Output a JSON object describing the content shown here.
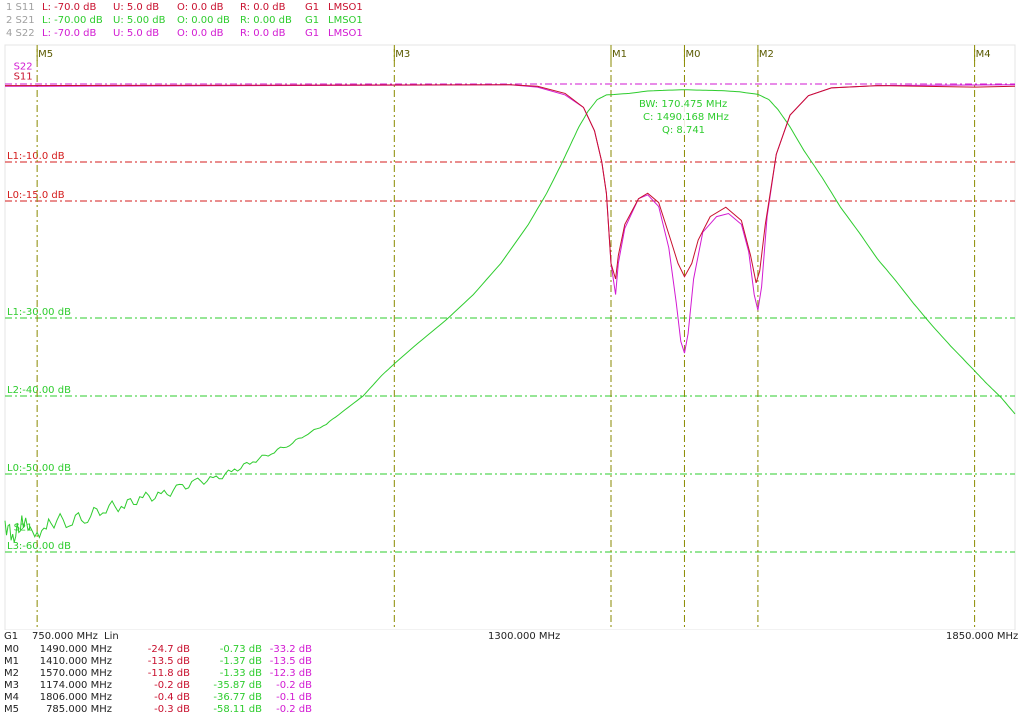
{
  "traces": [
    {
      "name": "1 S11",
      "L": "L: -70.0 dB",
      "U": "U: 5.0 dB",
      "O": "O: 0.0 dB",
      "R": "R: 0.0 dB",
      "group": "G1",
      "lms": "LMSO1",
      "color": "#c8102e",
      "namecolor": "#a0a0a0"
    },
    {
      "name": "2 S21",
      "L": "L: -70.00 dB",
      "U": "U: 5.00 dB",
      "O": "O: 0.00 dB",
      "R": "R: 0.00 dB",
      "group": "G1",
      "lms": "LMSO1",
      "color": "#2ecc2e",
      "namecolor": "#a0a0a0"
    },
    {
      "name": "4 S22",
      "L": "L: -70.0 dB",
      "U": "U: 5.0 dB",
      "O": "O: 0.0 dB",
      "R": "R: 0.0 dB",
      "group": "G1",
      "lms": "LMSO1",
      "color": "#d21ad2",
      "namecolor": "#a0a0a0"
    }
  ],
  "chart_data": {
    "type": "line",
    "x_unit": "MHz",
    "xlim": [
      750,
      1850
    ],
    "ylim": [
      -70,
      5
    ],
    "x_axis": {
      "group": "G1",
      "start": "750.000 MHz",
      "scale": "Lin",
      "center": "1300.000 MHz",
      "stop": "1850.000 MHz"
    },
    "limit_lines": [
      {
        "label": "L1:-10.0 dB",
        "value": -10,
        "color": "#d41c1c"
      },
      {
        "label": "L0:-15.0 dB",
        "value": -15,
        "color": "#d41c1c"
      },
      {
        "label": "L1:-30.00 dB",
        "value": -30,
        "color": "#2ecc2e"
      },
      {
        "label": "L2:-40.00 dB",
        "value": -40,
        "color": "#2ecc2e"
      },
      {
        "label": "L0:-50.00 dB",
        "value": -50,
        "color": "#2ecc2e"
      },
      {
        "label": "L3:-60.00 dB",
        "value": -60,
        "color": "#2ecc2e"
      }
    ],
    "markers": [
      {
        "name": "M5",
        "x": 785
      },
      {
        "name": "M3",
        "x": 1174
      },
      {
        "name": "M1",
        "x": 1410
      },
      {
        "name": "M0",
        "x": 1490
      },
      {
        "name": "M2",
        "x": 1570
      },
      {
        "name": "M4",
        "x": 1806
      }
    ],
    "trace_labels": [
      {
        "text": "S22",
        "color": "#d21ad2",
        "x": 755,
        "y": 2.4
      },
      {
        "text": "S11",
        "color": "#c8102e",
        "x": 755,
        "y": 1.1
      },
      {
        "text": "S21",
        "color": "#2ecc2e",
        "x": 755,
        "y": -56.7
      }
    ],
    "bw_info": {
      "bw": "BW: 170.475 MHz",
      "c": "C: 1490.168 MHz",
      "q": "Q: 8.741",
      "color": "#2ecc2e"
    },
    "series": [
      {
        "name": "S11",
        "color": "#c8102e",
        "points": [
          [
            750,
            -0.2
          ],
          [
            1300,
            -0.1
          ],
          [
            1330,
            -0.3
          ],
          [
            1360,
            -1.2
          ],
          [
            1380,
            -3
          ],
          [
            1392,
            -6
          ],
          [
            1400,
            -10
          ],
          [
            1405,
            -14
          ],
          [
            1410,
            -23
          ],
          [
            1415,
            -25
          ],
          [
            1418,
            -22
          ],
          [
            1425,
            -18
          ],
          [
            1440,
            -14.7
          ],
          [
            1450,
            -14
          ],
          [
            1462,
            -15.2
          ],
          [
            1475,
            -20
          ],
          [
            1483,
            -23
          ],
          [
            1490,
            -24.7
          ],
          [
            1498,
            -23
          ],
          [
            1505,
            -20
          ],
          [
            1518,
            -17
          ],
          [
            1535,
            -15.8
          ],
          [
            1552,
            -17.5
          ],
          [
            1562,
            -22
          ],
          [
            1568,
            -25.5
          ],
          [
            1572,
            -24
          ],
          [
            1578,
            -18
          ],
          [
            1590,
            -9
          ],
          [
            1605,
            -4
          ],
          [
            1625,
            -1.5
          ],
          [
            1650,
            -0.5
          ],
          [
            1700,
            -0.2
          ],
          [
            1806,
            -0.4
          ],
          [
            1850,
            -0.3
          ]
        ]
      },
      {
        "name": "S22",
        "color": "#d21ad2",
        "points": [
          [
            750,
            -0.3
          ],
          [
            785,
            -0.3
          ],
          [
            1300,
            -0.1
          ],
          [
            1330,
            -0.4
          ],
          [
            1360,
            -1.4
          ],
          [
            1380,
            -3
          ],
          [
            1392,
            -6
          ],
          [
            1400,
            -10
          ],
          [
            1405,
            -14
          ],
          [
            1410,
            -23
          ],
          [
            1415,
            -27
          ],
          [
            1418,
            -23
          ],
          [
            1425,
            -18.5
          ],
          [
            1440,
            -14.7
          ],
          [
            1450,
            -14.2
          ],
          [
            1462,
            -15.7
          ],
          [
            1473,
            -21
          ],
          [
            1481,
            -28
          ],
          [
            1486,
            -33
          ],
          [
            1490,
            -34.5
          ],
          [
            1494,
            -32
          ],
          [
            1500,
            -25
          ],
          [
            1510,
            -19
          ],
          [
            1525,
            -17
          ],
          [
            1538,
            -16.6
          ],
          [
            1552,
            -18
          ],
          [
            1560,
            -21.5
          ],
          [
            1566,
            -27
          ],
          [
            1570,
            -29
          ],
          [
            1574,
            -26
          ],
          [
            1580,
            -17
          ],
          [
            1590,
            -9
          ],
          [
            1605,
            -4
          ],
          [
            1625,
            -1.5
          ],
          [
            1650,
            -0.5
          ],
          [
            1700,
            -0.2
          ],
          [
            1850,
            -0.1
          ]
        ]
      },
      {
        "name": "S21",
        "color": "#2ecc2e",
        "points": [
          [
            750,
            -56.5
          ],
          [
            760,
            -58
          ],
          [
            770,
            -56
          ],
          [
            785,
            -58.1
          ],
          [
            800,
            -56
          ],
          [
            820,
            -56
          ],
          [
            840,
            -55.4
          ],
          [
            860,
            -54.3
          ],
          [
            880,
            -54
          ],
          [
            900,
            -53
          ],
          [
            920,
            -52.8
          ],
          [
            940,
            -51.8
          ],
          [
            960,
            -51
          ],
          [
            980,
            -50.6
          ],
          [
            1000,
            -49.5
          ],
          [
            1020,
            -48.4
          ],
          [
            1040,
            -47.3
          ],
          [
            1060,
            -46.2
          ],
          [
            1080,
            -44.8
          ],
          [
            1100,
            -43.6
          ],
          [
            1120,
            -41.8
          ],
          [
            1140,
            -40
          ],
          [
            1160,
            -37.4
          ],
          [
            1174,
            -35.87
          ],
          [
            1200,
            -33.2
          ],
          [
            1230,
            -30.3
          ],
          [
            1260,
            -27
          ],
          [
            1290,
            -23
          ],
          [
            1320,
            -18
          ],
          [
            1340,
            -14
          ],
          [
            1355,
            -10.5
          ],
          [
            1365,
            -8
          ],
          [
            1375,
            -5.5
          ],
          [
            1385,
            -3.5
          ],
          [
            1395,
            -2
          ],
          [
            1405,
            -1.4
          ],
          [
            1410,
            -1.37
          ],
          [
            1430,
            -1.2
          ],
          [
            1450,
            -0.9
          ],
          [
            1470,
            -0.8
          ],
          [
            1490,
            -0.73
          ],
          [
            1510,
            -0.8
          ],
          [
            1530,
            -0.85
          ],
          [
            1550,
            -1.0
          ],
          [
            1570,
            -1.33
          ],
          [
            1582,
            -2
          ],
          [
            1592,
            -3.3
          ],
          [
            1605,
            -5.5
          ],
          [
            1620,
            -8.5
          ],
          [
            1640,
            -12
          ],
          [
            1660,
            -15.8
          ],
          [
            1680,
            -19
          ],
          [
            1700,
            -22.4
          ],
          [
            1720,
            -25.2
          ],
          [
            1740,
            -28.2
          ],
          [
            1760,
            -31
          ],
          [
            1780,
            -33.6
          ],
          [
            1806,
            -36.77
          ],
          [
            1820,
            -38.5
          ],
          [
            1835,
            -40.2
          ],
          [
            1850,
            -42.3
          ]
        ]
      }
    ]
  },
  "marker_table": {
    "rows": [
      {
        "name": "M0",
        "freq": "1490.000 MHz",
        "s11": "-24.7 dB",
        "s21": "-0.73 dB",
        "s22": "-33.2 dB"
      },
      {
        "name": "M1",
        "freq": "1410.000 MHz",
        "s11": "-13.5 dB",
        "s21": "-1.37 dB",
        "s22": "-13.5 dB"
      },
      {
        "name": "M2",
        "freq": "1570.000 MHz",
        "s11": "-11.8 dB",
        "s21": "-1.33 dB",
        "s22": "-12.3 dB"
      },
      {
        "name": "M3",
        "freq": "1174.000 MHz",
        "s11": "-0.2 dB",
        "s21": "-35.87 dB",
        "s22": "-0.2 dB"
      },
      {
        "name": "M4",
        "freq": "1806.000 MHz",
        "s11": "-0.4 dB",
        "s21": "-36.77 dB",
        "s22": "-0.1 dB"
      },
      {
        "name": "M5",
        "freq": "785.000 MHz",
        "s11": "-0.3 dB",
        "s21": "-58.11 dB",
        "s22": "-0.2 dB"
      }
    ]
  },
  "colors": {
    "marker_line": "#8a8a00",
    "grid_tick": "#8a8a00",
    "text": "#222222",
    "s11": "#c8102e",
    "s21": "#2ecc2e",
    "s22": "#d21ad2",
    "reference": "#d21ad2"
  }
}
